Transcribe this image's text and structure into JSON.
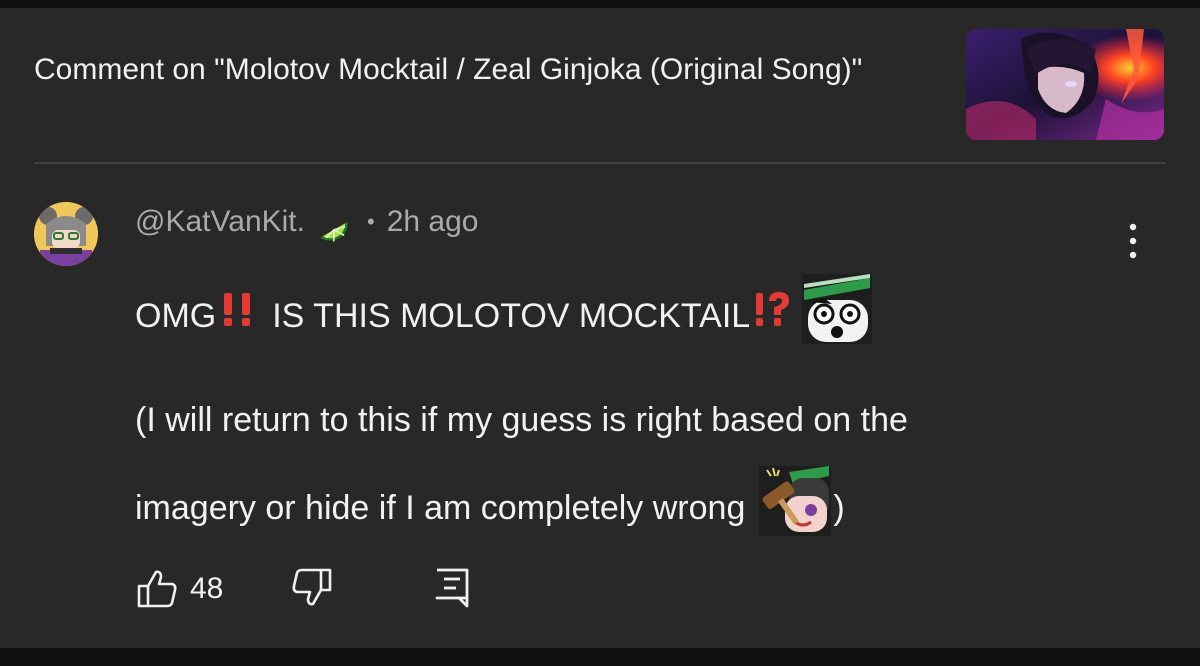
{
  "header": {
    "title": "Comment on \"Molotov Mocktail / Zeal Ginjoka (Original Song)\""
  },
  "comment": {
    "author": "@KatVanKit.",
    "timestamp": "2h ago",
    "separator": "•",
    "line1_a": "OMG",
    "line1_b": "IS THIS MOLOTOV MOCKTAIL",
    "line2": "(I will return to this if my guess is right based on the",
    "line3_a": "imagery or hide if I am completely wrong",
    "line3_b": ")",
    "emoji": [
      "double-exclamation",
      "exclamation-question",
      "shocked-face-emote",
      "hammer-face-emote"
    ],
    "badge_icon": "lime-slice-icon"
  },
  "actions": {
    "like_count": "48",
    "icons": [
      "thumbs-up-icon",
      "thumbs-down-icon",
      "reply-icon"
    ]
  },
  "colors": {
    "background": "#282828",
    "text": "#f1f1f1",
    "muted": "#aaaaaa",
    "accent_red": "#e53935"
  }
}
